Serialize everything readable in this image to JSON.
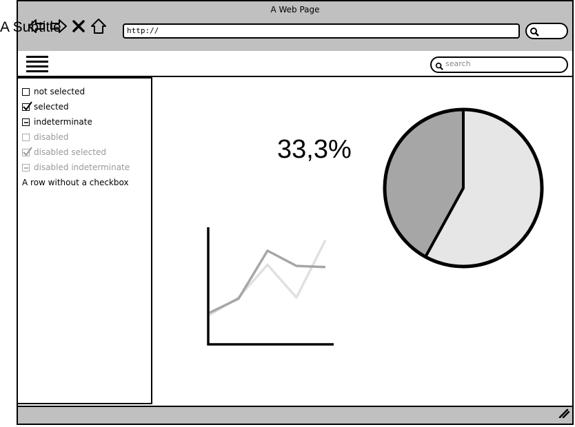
{
  "window": {
    "title": "A Web Page",
    "subtitle_overlay": "A Subtitle"
  },
  "browser": {
    "url": "http://",
    "icons": [
      "back-arrow-icon",
      "forward-arrow-icon",
      "close-x-icon",
      "home-icon",
      "search-icon"
    ]
  },
  "toolbar": {
    "menu_icon": "hamburger-menu-icon",
    "search_placeholder": "search"
  },
  "sidebar": {
    "items": [
      {
        "label": "not selected",
        "state": "unchecked",
        "disabled": false
      },
      {
        "label": "selected",
        "state": "checked",
        "disabled": false
      },
      {
        "label": "indeterminate",
        "state": "indeterminate",
        "disabled": false
      },
      {
        "label": "disabled",
        "state": "unchecked",
        "disabled": true
      },
      {
        "label": "disabled selected",
        "state": "checked",
        "disabled": true
      },
      {
        "label": "disabled indeterminate",
        "state": "indeterminate",
        "disabled": true
      }
    ],
    "plain_row": "A row without a checkbox"
  },
  "main": {
    "big_number": "33,3%"
  },
  "colors": {
    "chrome_gray": "#c0c0c0",
    "pie_dark": "#a6a6a6",
    "pie_light": "#e6e6e6",
    "line_dark": "#a6a6a6",
    "line_light": "#e0e0e0"
  },
  "chart_data": [
    {
      "type": "pie",
      "values": [
        58,
        42
      ]
    },
    {
      "type": "line",
      "x": [
        0,
        1,
        2,
        3,
        4
      ],
      "series": [
        {
          "values": [
            25,
            40,
            68,
            40,
            89
          ]
        },
        {
          "values": [
            27,
            39,
            80,
            67,
            66
          ]
        }
      ],
      "ylim": [
        0,
        100
      ]
    }
  ]
}
